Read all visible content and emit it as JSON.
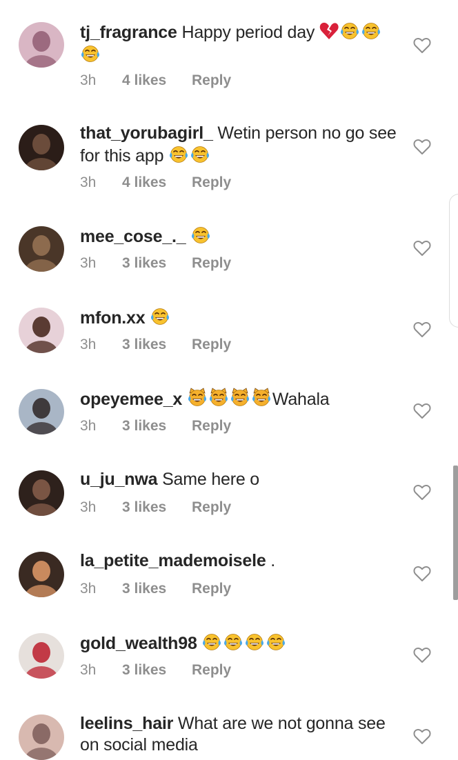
{
  "comments": [
    {
      "username": "tj_fragrance",
      "text": " Happy period day ",
      "emojis": [
        "broken-heart",
        "joy",
        "joy",
        "joy"
      ],
      "time": "3h",
      "likes": "4 likes",
      "reply": "Reply",
      "avatar_colors": [
        "#d9b6c4",
        "#9c6a7f"
      ]
    },
    {
      "username": "that_yorubagirl_",
      "text": " Wetin person no go see for this app ",
      "emojis": [
        "joy",
        "joy"
      ],
      "time": "3h",
      "likes": "4 likes",
      "reply": "Reply",
      "avatar_colors": [
        "#2b1d18",
        "#6b4c3b"
      ]
    },
    {
      "username": "mee_cose_._",
      "text": " ",
      "emojis": [
        "joy"
      ],
      "time": "3h",
      "likes": "3 likes",
      "reply": "Reply",
      "avatar_colors": [
        "#4a3628",
        "#8d6b4e"
      ]
    },
    {
      "username": "mfon.xx",
      "text": " ",
      "emojis": [
        "joy"
      ],
      "time": "3h",
      "likes": "3 likes",
      "reply": "Reply",
      "avatar_colors": [
        "#e7d1d8",
        "#5a3b33"
      ]
    },
    {
      "username": "opeyemee_x",
      "text": " ",
      "emojis": [
        "cat-joy",
        "cat-joy",
        "cat-joy",
        "cat-joy"
      ],
      "after_text": "Wahala",
      "time": "3h",
      "likes": "3 likes",
      "reply": "Reply",
      "avatar_colors": [
        "#a9b6c6",
        "#3f3a3c"
      ]
    },
    {
      "username": "u_ju_nwa",
      "text": " Same here o",
      "emojis": [],
      "time": "3h",
      "likes": "3 likes",
      "reply": "Reply",
      "avatar_colors": [
        "#2e211c",
        "#7a5544"
      ]
    },
    {
      "username": "la_petite_mademoisele",
      "text": " .",
      "emojis": [],
      "time": "3h",
      "likes": "3 likes",
      "reply": "Reply",
      "avatar_colors": [
        "#3a2a22",
        "#c98a5e"
      ]
    },
    {
      "username": "gold_wealth98",
      "text": " ",
      "emojis": [
        "joy",
        "joy",
        "joy",
        "joy"
      ],
      "time": "3h",
      "likes": "3 likes",
      "reply": "Reply",
      "avatar_colors": [
        "#e6e0dc",
        "#c23a46"
      ]
    },
    {
      "username": "leelins_hair",
      "text": " What are we not gonna see on social media",
      "emojis": [],
      "time": "",
      "likes": "",
      "reply": "",
      "avatar_colors": [
        "#d8b9b0",
        "#8a6a66"
      ]
    }
  ]
}
